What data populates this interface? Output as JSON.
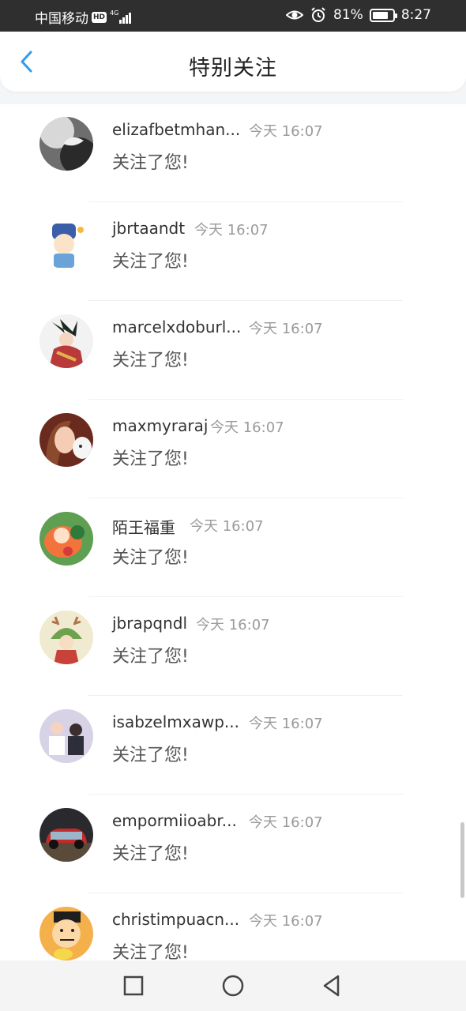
{
  "status_bar": {
    "carrier": "中国移动",
    "hd": "HD",
    "network": "4G",
    "battery": "81%",
    "battery_fraction": 0.81,
    "time": "8:27"
  },
  "header": {
    "title": "特别关注"
  },
  "follows": [
    {
      "name": "elizafbetmhan...",
      "time": "今天 16:07",
      "message": "关注了您!"
    },
    {
      "name": "jbrtaandt",
      "time": "今天 16:07",
      "message": "关注了您!"
    },
    {
      "name": "marcelxdoburl...",
      "time": "今天 16:07",
      "message": "关注了您!"
    },
    {
      "name": "maxmyraraj",
      "time": "今天 16:07",
      "message": "关注了您!"
    },
    {
      "name": "陌王福重",
      "time": "今天 16:07",
      "message": "关注了您!"
    },
    {
      "name": "jbrapqndl",
      "time": "今天 16:07",
      "message": "关注了您!"
    },
    {
      "name": "isabzelmxawp...",
      "time": "今天 16:07",
      "message": "关注了您!"
    },
    {
      "name": "empormiioabr...",
      "time": "今天 16:07",
      "message": "关注了您!"
    },
    {
      "name": "christimpuacn...",
      "time": "今天 16:07",
      "message": "关注了您!"
    }
  ],
  "colors": {
    "accent": "#2f9cf0",
    "status_bar_bg": "#2f2f2f"
  }
}
